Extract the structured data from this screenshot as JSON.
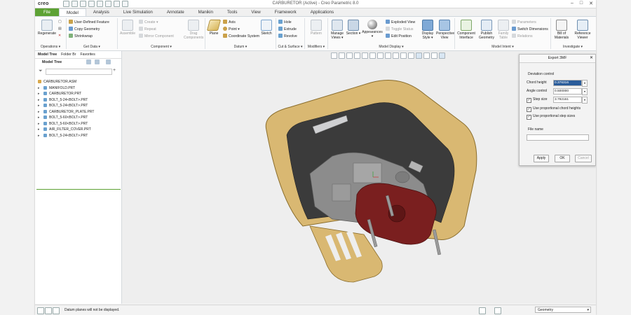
{
  "app": {
    "logo": "creo",
    "window_title": "CARBURETOR (Active) - Creo Parametric 8.0",
    "min_glyph": "–",
    "max_glyph": "□",
    "close_glyph": "✕"
  },
  "tabs": [
    "File",
    "Model",
    "Analysis",
    "Live Simulation",
    "Annotate",
    "Manikin",
    "Tools",
    "View",
    "Framework",
    "Applications"
  ],
  "ribbon": {
    "operations": {
      "label": "Operations ▾",
      "regenerate": "Regenerate"
    },
    "get_data": {
      "label": "Get Data ▾",
      "items": [
        "User-Defined Feature",
        "Copy Geometry",
        "Shrinkwrap"
      ]
    },
    "component": {
      "label": "Component ▾",
      "assemble": "Assemble",
      "items": [
        "Create ▾",
        "Repeat",
        "Mirror Component"
      ],
      "drag": "Drag Components"
    },
    "datum": {
      "label": "Datum ▾",
      "plane": "Plane",
      "items": [
        "Axis",
        "Point ▾",
        "Coordinate System"
      ],
      "sketch": "Sketch"
    },
    "cut_surface": {
      "label": "Cut & Surface ▾",
      "items": [
        "Hole",
        "Extrude",
        "Revolve"
      ]
    },
    "modifiers": {
      "label": "Modifiers ▾",
      "pattern": "Pattern"
    },
    "model_display": {
      "label": "Model Display ▾",
      "manage_views": "Manage Views ▾",
      "section": "Section ▾",
      "appearances": "Appearances ▾",
      "items": [
        "Exploded View",
        "Toggle Status",
        "Edit Position"
      ],
      "display_style": "Display Style ▾",
      "perspective": "Perspective View"
    },
    "model_intent": {
      "label": "Model Intent ▾",
      "component_interface": "Component Interface",
      "publish_geometry": "Publish Geometry",
      "family_table": "Family Table",
      "items": [
        "Parameters",
        "Switch Dimensions",
        "Relations"
      ]
    },
    "investigate": {
      "label": "Investigate ▾",
      "bom": "Bill of Materials",
      "reference_viewer": "Reference Viewer"
    }
  },
  "panel": {
    "tabs": [
      "Model Tree",
      "Folder Br",
      "Favorites"
    ],
    "title": "Model Tree",
    "tree": [
      {
        "name": "CARBURETOR.ASM",
        "type": "asm",
        "expand": ""
      },
      {
        "name": "MANIFOLD.PRT",
        "type": "prt",
        "expand": "▸"
      },
      {
        "name": "CARBURETOR.PRT",
        "type": "prt",
        "expand": "▸"
      },
      {
        "name": "BOLT_5-24<BOLT>.PRT",
        "type": "prt",
        "expand": "▸"
      },
      {
        "name": "BOLT_5-24<BOLT>.PRT",
        "type": "prt",
        "expand": "▸"
      },
      {
        "name": "CARBURETOR_PLATE.PRT",
        "type": "prt",
        "expand": "▸"
      },
      {
        "name": "BOLT_5-60<BOLT>.PRT",
        "type": "prt",
        "expand": "▸"
      },
      {
        "name": "BOLT_5-60<BOLT>.PRT",
        "type": "prt",
        "expand": "▸"
      },
      {
        "name": "AIR_FILTER_COVER.PRT",
        "type": "prt",
        "expand": "▸"
      },
      {
        "name": "BOLT_5-24<BOLT>.PRT",
        "type": "prt",
        "expand": "▸"
      }
    ]
  },
  "dialog": {
    "title": "Export 3MF",
    "section_label": "Deviation control",
    "chord_label": "Chord height",
    "chord_value": "0.376316",
    "angle_label": "Angle control",
    "angle_value": "0.500000",
    "step_label": "Step size",
    "step_value": "3.792161",
    "prop_chord": "Use proportional chord heights",
    "prop_step": "Use proportional step sizes",
    "file_label": "File name",
    "file_value": "",
    "apply": "Apply",
    "ok": "OK",
    "cancel": "Cancel"
  },
  "status": {
    "message": "Datum planes will not be displayed.",
    "filter": "Geometry"
  },
  "colors": {
    "file_tab": "#5da234",
    "cover": "#d9b872",
    "plate": "#7a1f1f",
    "body": "#8c8c8c"
  }
}
